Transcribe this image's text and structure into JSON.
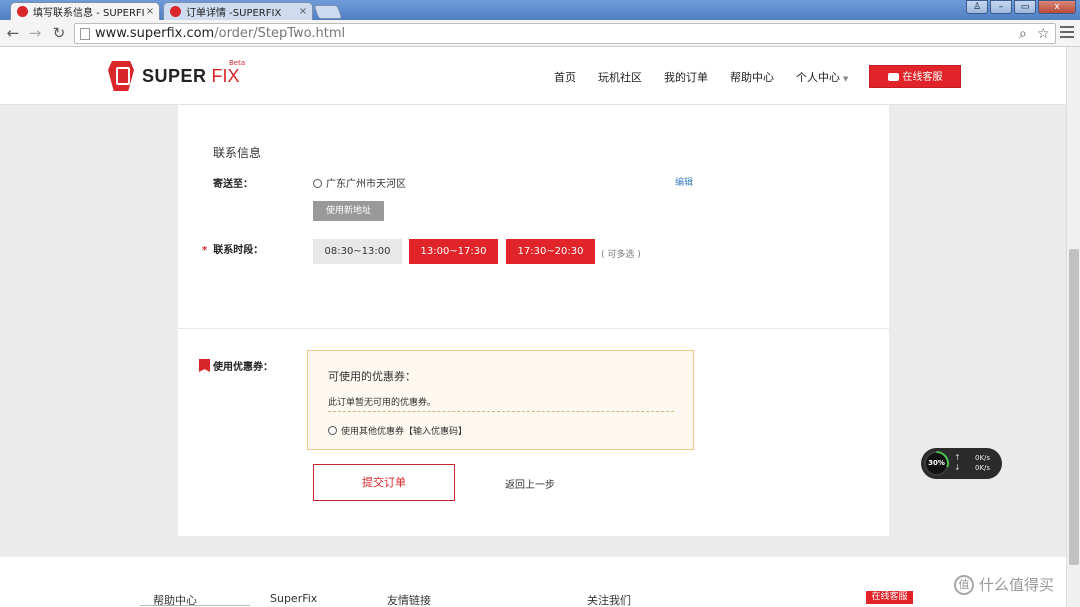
{
  "browser": {
    "tabs": [
      {
        "label": "填写联系信息 - SUPERFIX",
        "close": "×"
      },
      {
        "label": "订单详情 -SUPERFIX",
        "close": "×"
      }
    ],
    "url_host": "www.superfix.com",
    "url_path": "/order/StepTwo.html",
    "window_buttons": {
      "min": "–",
      "max": "▭",
      "close": "x",
      "user": "♙"
    }
  },
  "header": {
    "logo_super": "SUPER",
    "logo_fix": "FIX",
    "logo_beta": "Beta",
    "nav": [
      "首页",
      "玩机社区",
      "我的订单",
      "帮助中心",
      "个人中心"
    ],
    "service_button": "在线客服"
  },
  "contact": {
    "section_title": "联系信息",
    "ship_label": "寄送至：",
    "address": "广东广州市天河区",
    "edit_link": "编辑",
    "new_address_button": "使用新地址",
    "required_mark": "*",
    "time_label": "联系时段：",
    "time_slots": [
      {
        "label": "08:30~13:00",
        "selected": false
      },
      {
        "label": "13:00~17:30",
        "selected": true
      },
      {
        "label": "17:30~20:30",
        "selected": true
      }
    ],
    "multi_note": "( 可多选 )"
  },
  "coupon": {
    "label": "使用优惠券：",
    "box_title": "可使用的优惠券：",
    "none_text": "此订单暂无可用的优惠券。",
    "other_option": "使用其他优惠券【输入优惠码】"
  },
  "actions": {
    "submit": "提交订单",
    "back": "返回上一步"
  },
  "footer": {
    "items": [
      "帮助中心",
      "SuperFix",
      "友情链接",
      "关注我们"
    ],
    "service": "在线客服"
  },
  "watermark": {
    "icon": "值",
    "text": "什么值得买"
  },
  "speed_widget": {
    "percent": "30%",
    "progress_fraction": 0.3,
    "up_arrow": "↑",
    "down_arrow": "↓",
    "up_speed": "0K/s",
    "down_speed": "0K/s"
  },
  "colors": {
    "brand_red": "#e0242a",
    "link_blue": "#3c7ebf",
    "coupon_border": "#f0c784"
  }
}
